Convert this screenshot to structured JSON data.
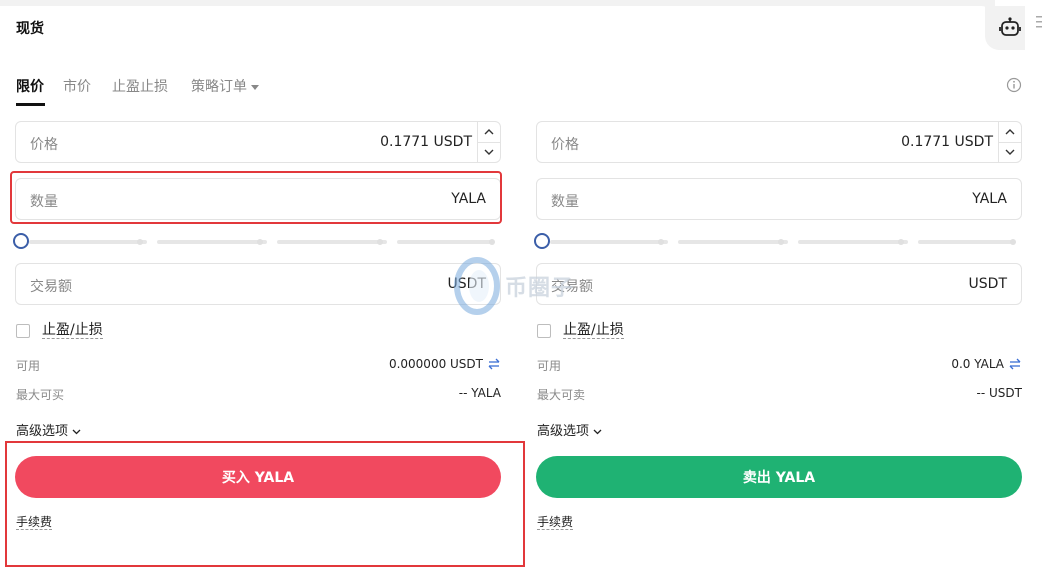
{
  "header": {
    "title": "现货"
  },
  "tabs": [
    {
      "label": "限价",
      "active": true
    },
    {
      "label": "市价",
      "active": false
    },
    {
      "label": "止盈止损",
      "active": false
    },
    {
      "label": "策略订单",
      "active": false
    }
  ],
  "buy": {
    "price_label": "价格",
    "price_value": "0.1771 USDT",
    "qty_label": "数量",
    "qty_unit": "YALA",
    "slider_percent": 0,
    "amount_label": "交易额",
    "amount_unit": "USDT",
    "tpsl_label": "止盈/止损",
    "available_label": "可用",
    "available_value": "0.000000 USDT",
    "max_label": "最大可买",
    "max_value": "-- YALA",
    "advanced_label": "高级选项",
    "button_label": "买入 YALA",
    "fee_label": "手续费"
  },
  "sell": {
    "price_label": "价格",
    "price_value": "0.1771 USDT",
    "qty_label": "数量",
    "qty_unit": "YALA",
    "slider_percent": 0,
    "amount_label": "交易额",
    "amount_unit": "USDT",
    "tpsl_label": "止盈/止损",
    "available_label": "可用",
    "available_value": "0.0 YALA",
    "max_label": "最大可卖",
    "max_value": "-- USDT",
    "advanced_label": "高级选项",
    "button_label": "卖出 YALA",
    "fee_label": "手续费"
  },
  "watermark": {
    "text": "币圈子"
  },
  "colors": {
    "buy": "#f1495f",
    "sell": "#1fb273",
    "highlight": "#e2383b",
    "slider_thumb": "#3b5ea8",
    "swap_icon": "#3b6fd4"
  },
  "icons": [
    "robot-icon",
    "menu-dots-icon",
    "info-icon",
    "chevron-up-icon",
    "chevron-down-icon",
    "swap-icon",
    "watermark-logo"
  ]
}
